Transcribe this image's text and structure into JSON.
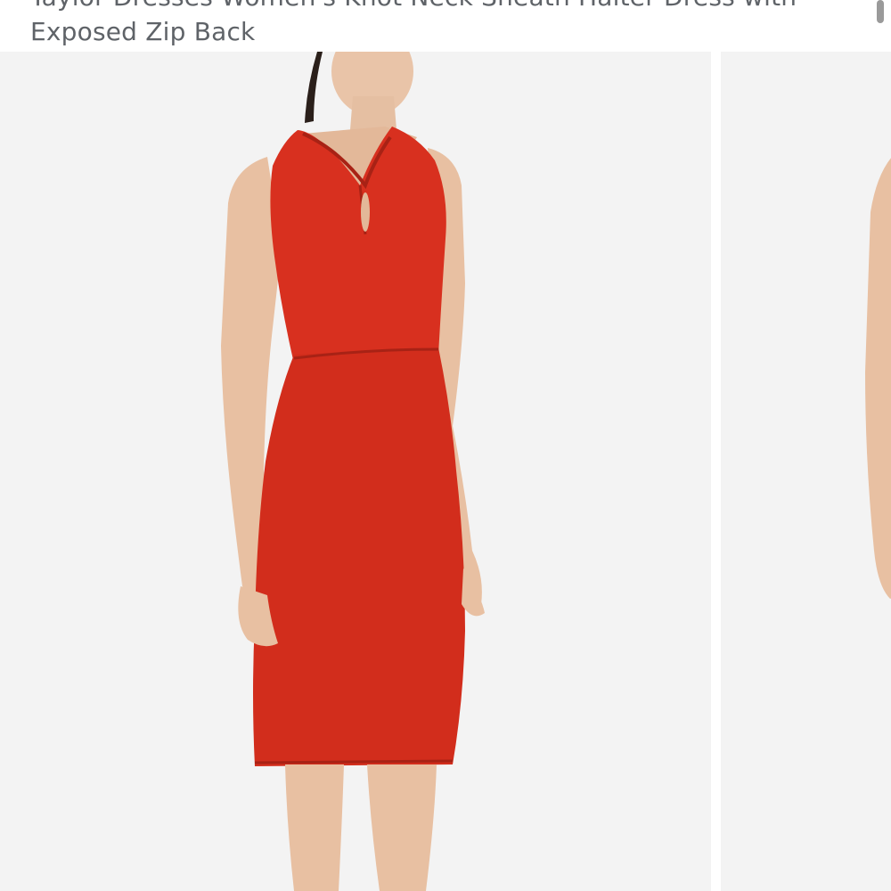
{
  "product": {
    "title_line_1": "Taylor Dresses Women's Knot Neck Sheath Halter Dress with",
    "title_line_2": "Exposed Zip Back"
  },
  "gallery": {
    "image_count_visible": 2
  },
  "colors": {
    "dress": "#d8301f",
    "background": "#f3f3f3",
    "title_text": "#5f6368"
  }
}
